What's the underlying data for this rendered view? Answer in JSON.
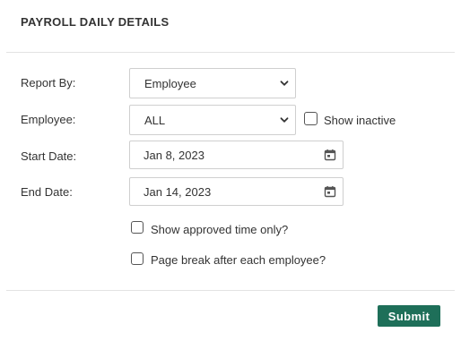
{
  "dialog": {
    "title": "PAYROLL DAILY DETAILS"
  },
  "form": {
    "report_by": {
      "label": "Report By:",
      "value": "Employee"
    },
    "employee": {
      "label": "Employee:",
      "value": "ALL",
      "show_inactive_label": "Show inactive",
      "show_inactive_checked": false
    },
    "start_date": {
      "label": "Start Date:",
      "value": "Jan 8, 2023"
    },
    "end_date": {
      "label": "End Date:",
      "value": "Jan 14, 2023"
    },
    "options": {
      "approved_only_label": "Show approved time only?",
      "approved_only_checked": false,
      "page_break_label": "Page break after each employee?",
      "page_break_checked": false
    }
  },
  "footer": {
    "submit_label": "Submit"
  },
  "colors": {
    "submit_bg": "#1e6f59",
    "divider": "#e3e3e3",
    "border": "#cfcfcf"
  },
  "icons": {
    "dropdown": "chevron-down-icon",
    "date": "calendar-icon"
  }
}
